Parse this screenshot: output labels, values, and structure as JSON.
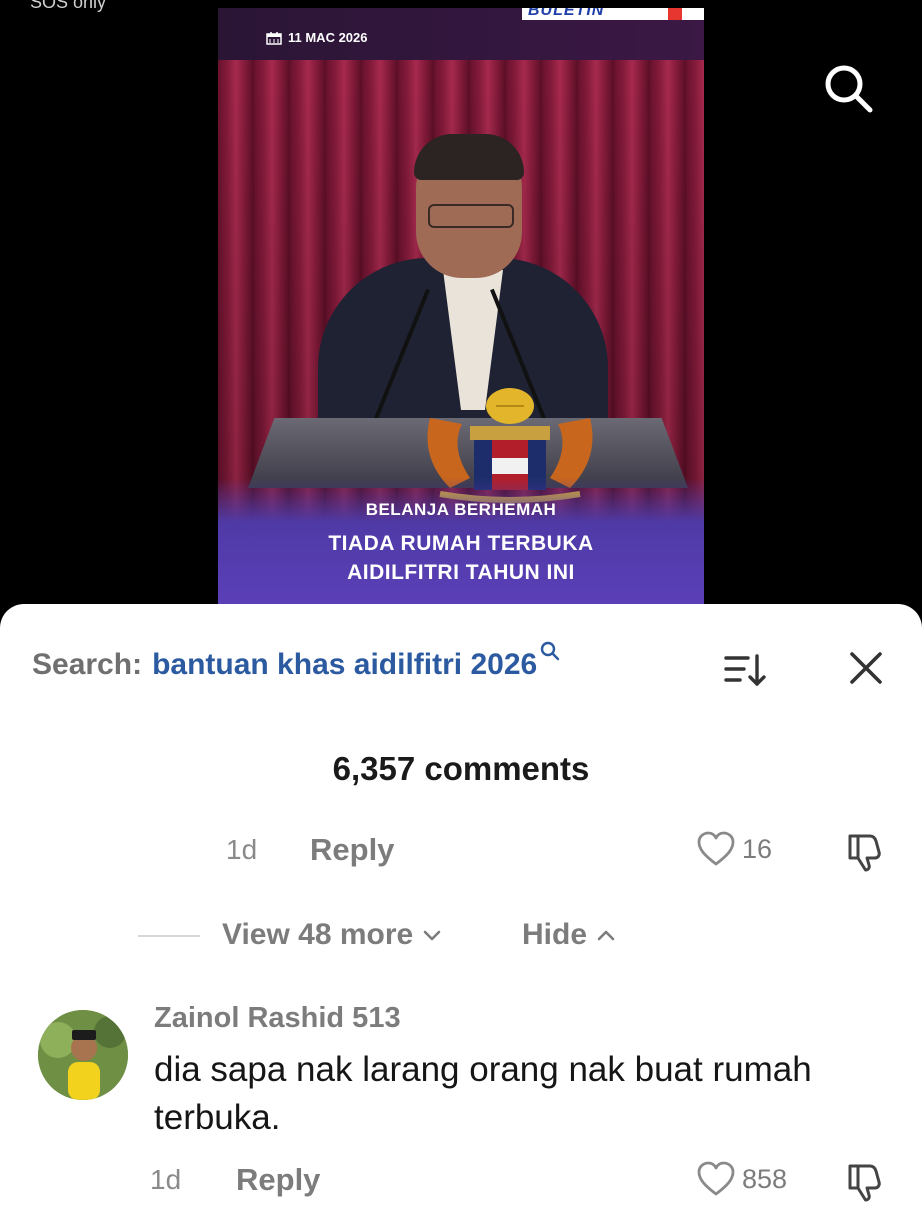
{
  "status_bar": {
    "text": "SOS only"
  },
  "video": {
    "date": "11 MAC 2026",
    "brand": "BULETIN",
    "caption_line1": "BELANJA BERHEMAH",
    "caption_line2": "TIADA RUMAH TERBUKA",
    "caption_line3": "AIDILFITRI TAHUN INI"
  },
  "comments_panel": {
    "search_prefix": "Search:",
    "search_term": "bantuan khas aidilfitri 2026",
    "count_label": "6,357 comments",
    "first_comment": {
      "time": "1d",
      "reply_label": "Reply",
      "likes": "16"
    },
    "replies_toggle": {
      "view_more_label": "View 48 more",
      "hide_label": "Hide"
    },
    "second_comment": {
      "username": "Zainol Rashid 513",
      "text": "dia sapa nak larang orang nak buat rumah terbuka.",
      "time": "1d",
      "reply_label": "Reply",
      "likes": "858"
    }
  },
  "colors": {
    "search_term": "#2c5aa0",
    "caption_band": "#5b3fb8",
    "curtain": "#8e1d3f"
  }
}
